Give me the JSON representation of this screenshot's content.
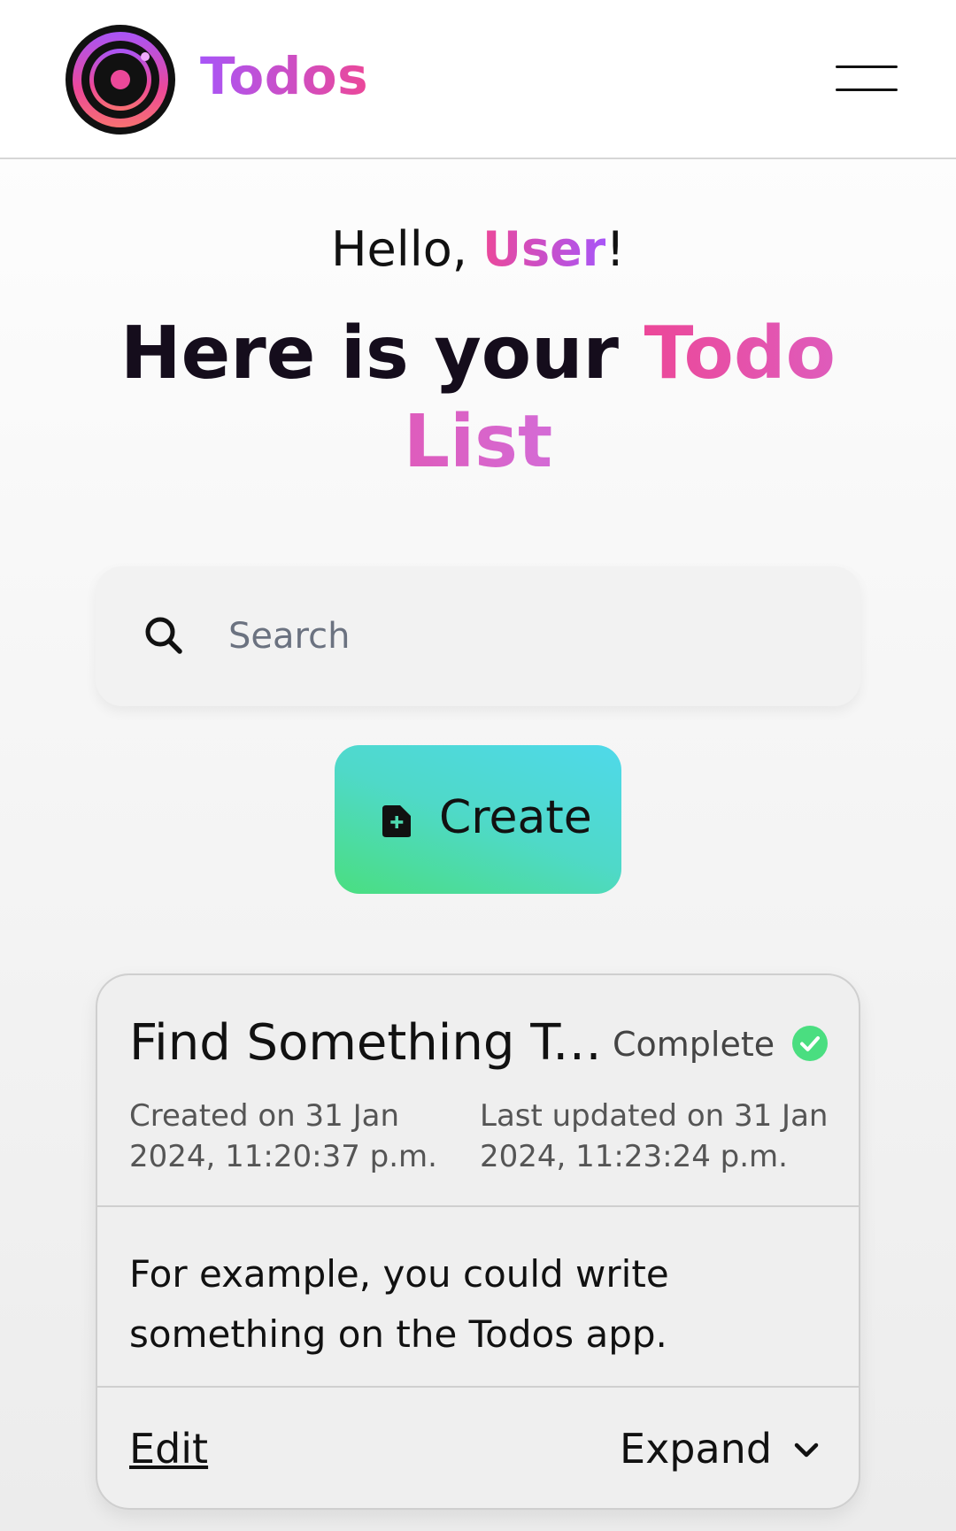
{
  "app": {
    "brand": "Todos",
    "logo_icon": "vinyl-record-logo-icon",
    "menu_icon": "hamburger-menu-icon"
  },
  "greeting": {
    "prefix": "Hello, ",
    "name": "User",
    "suffix": "!"
  },
  "headline": {
    "text": "Here is your ",
    "accent": "Todo List"
  },
  "search": {
    "placeholder": "Search",
    "value": "",
    "icon": "search-icon"
  },
  "create_button": {
    "label": "Create",
    "icon": "file-plus-icon"
  },
  "todos": [
    {
      "title": "Find Something To Do",
      "status": "Complete",
      "status_icon": "check-circle-icon",
      "created": "Created on 31 Jan 2024, 11:20:37 p.m.",
      "updated": "Last updated on 31 Jan 2024, 11:23:24 p.m.",
      "description": "For example, you could write something on the Todos app.",
      "edit_label": "Edit",
      "expand_label": "Expand",
      "expand_icon": "chevron-down-icon"
    }
  ],
  "colors": {
    "brand_gradient_start": "#a855f7",
    "brand_gradient_end": "#ec4899",
    "create_gradient_start": "#4ade80",
    "create_gradient_end": "#4fd9ea",
    "status_complete": "#4ade80"
  }
}
